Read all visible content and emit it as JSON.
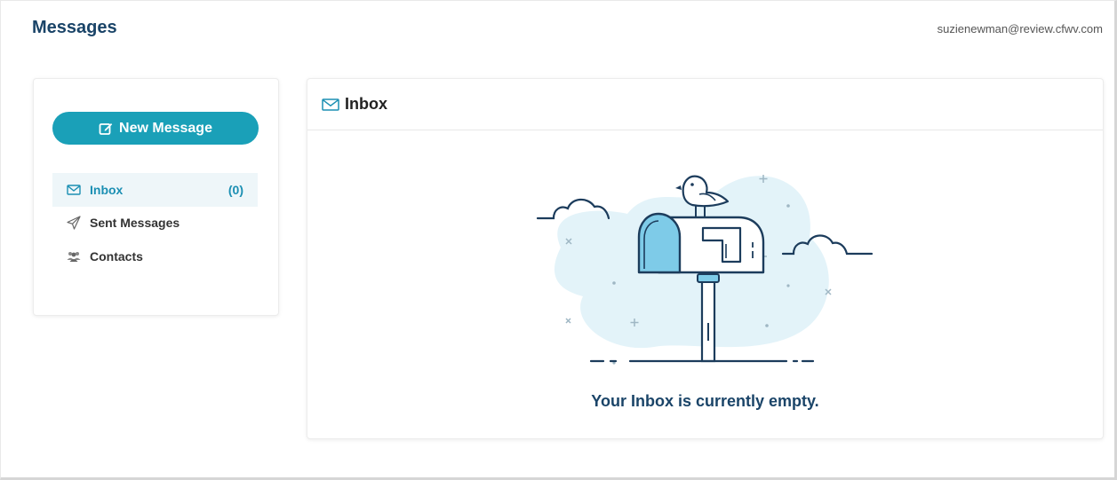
{
  "header": {
    "title": "Messages",
    "user_email": "suzienewman@review.cfwv.com"
  },
  "sidebar": {
    "new_message_label": "New Message",
    "items": [
      {
        "label": "Inbox",
        "count": "(0)",
        "icon": "envelope-icon",
        "active": true
      },
      {
        "label": "Sent Messages",
        "icon": "paper-plane-icon",
        "active": false
      },
      {
        "label": "Contacts",
        "icon": "users-icon",
        "active": false
      }
    ]
  },
  "main": {
    "panel_title": "Inbox",
    "empty_message": "Your Inbox is currently empty.",
    "illustration": "empty-mailbox-with-bird"
  },
  "colors": {
    "accent": "#1aa0b8",
    "title": "#1a4468",
    "active_bg": "#eef6f9",
    "illustration_blob": "#e3f3f9",
    "illustration_stroke": "#1c3c5c",
    "mailbox_door": "#7ecbe8"
  }
}
